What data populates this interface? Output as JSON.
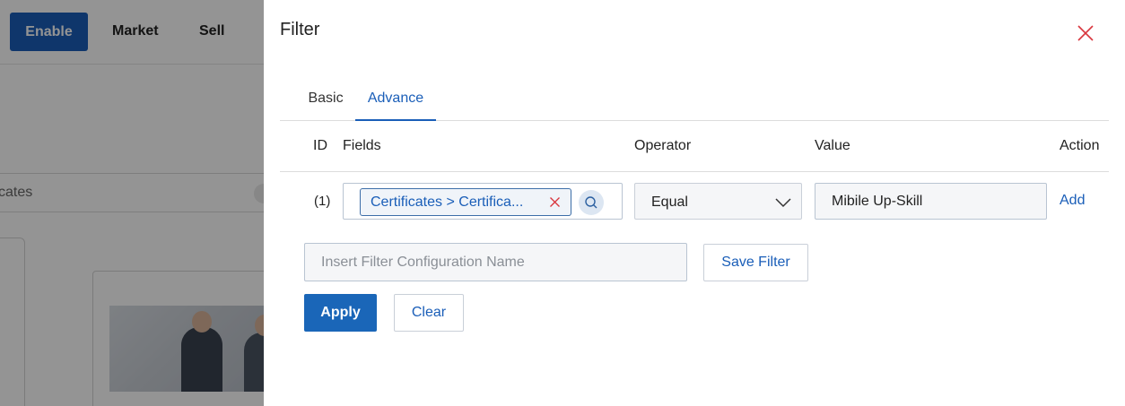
{
  "background": {
    "nav": {
      "enable_label": "Enable",
      "market_label": "Market",
      "sell_label": "Sell"
    },
    "search_text": "cates"
  },
  "filter": {
    "title": "Filter",
    "tabs": [
      {
        "label": "Basic",
        "active": false
      },
      {
        "label": "Advance",
        "active": true
      }
    ],
    "columns": {
      "id": "ID",
      "fields": "Fields",
      "operator": "Operator",
      "value": "Value",
      "action": "Action"
    },
    "rows": [
      {
        "id": "(1)",
        "field_chip": "Certificates > Certifica...",
        "operator": "Equal",
        "value": "Mibile Up-Skill",
        "action": "Add"
      }
    ],
    "config_name_placeholder": "Insert Filter Configuration Name",
    "save_filter_label": "Save Filter",
    "apply_label": "Apply",
    "clear_label": "Clear"
  },
  "colors": {
    "accent": "#1a5eb8",
    "close_icon": "#d9363e",
    "overlay": "rgba(0,0,0,0.42)"
  },
  "icons": [
    "close-icon",
    "chip-remove-icon",
    "search-icon",
    "chevron-down-icon"
  ]
}
